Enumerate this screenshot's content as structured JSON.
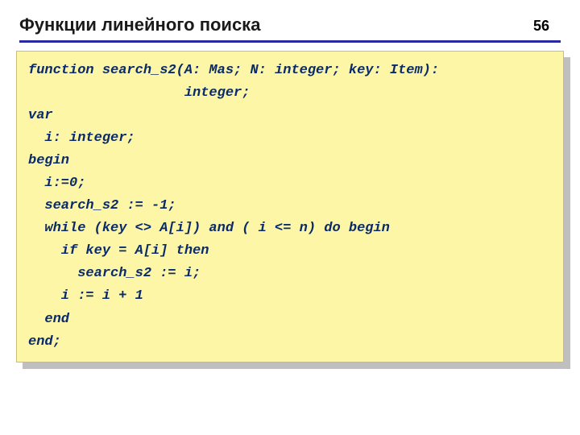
{
  "slide": {
    "title": "Функции линейного поиска",
    "page_number": "56"
  },
  "code": {
    "l01": "function search_s2(A: Mas; N: integer; key: Item):",
    "l02": "                   integer;",
    "l03": "var",
    "l04": "  i: integer;",
    "l05": "begin",
    "l06": "  i:=0;",
    "l07": "  search_s2 := -1;",
    "l08": "  while (key <> A[i]) and ( i <= n) do begin",
    "l09": "    if key = A[i] then",
    "l10": "      search_s2 := i;",
    "l11": "    i := i + 1",
    "l12": "  end",
    "l13": "end;"
  }
}
